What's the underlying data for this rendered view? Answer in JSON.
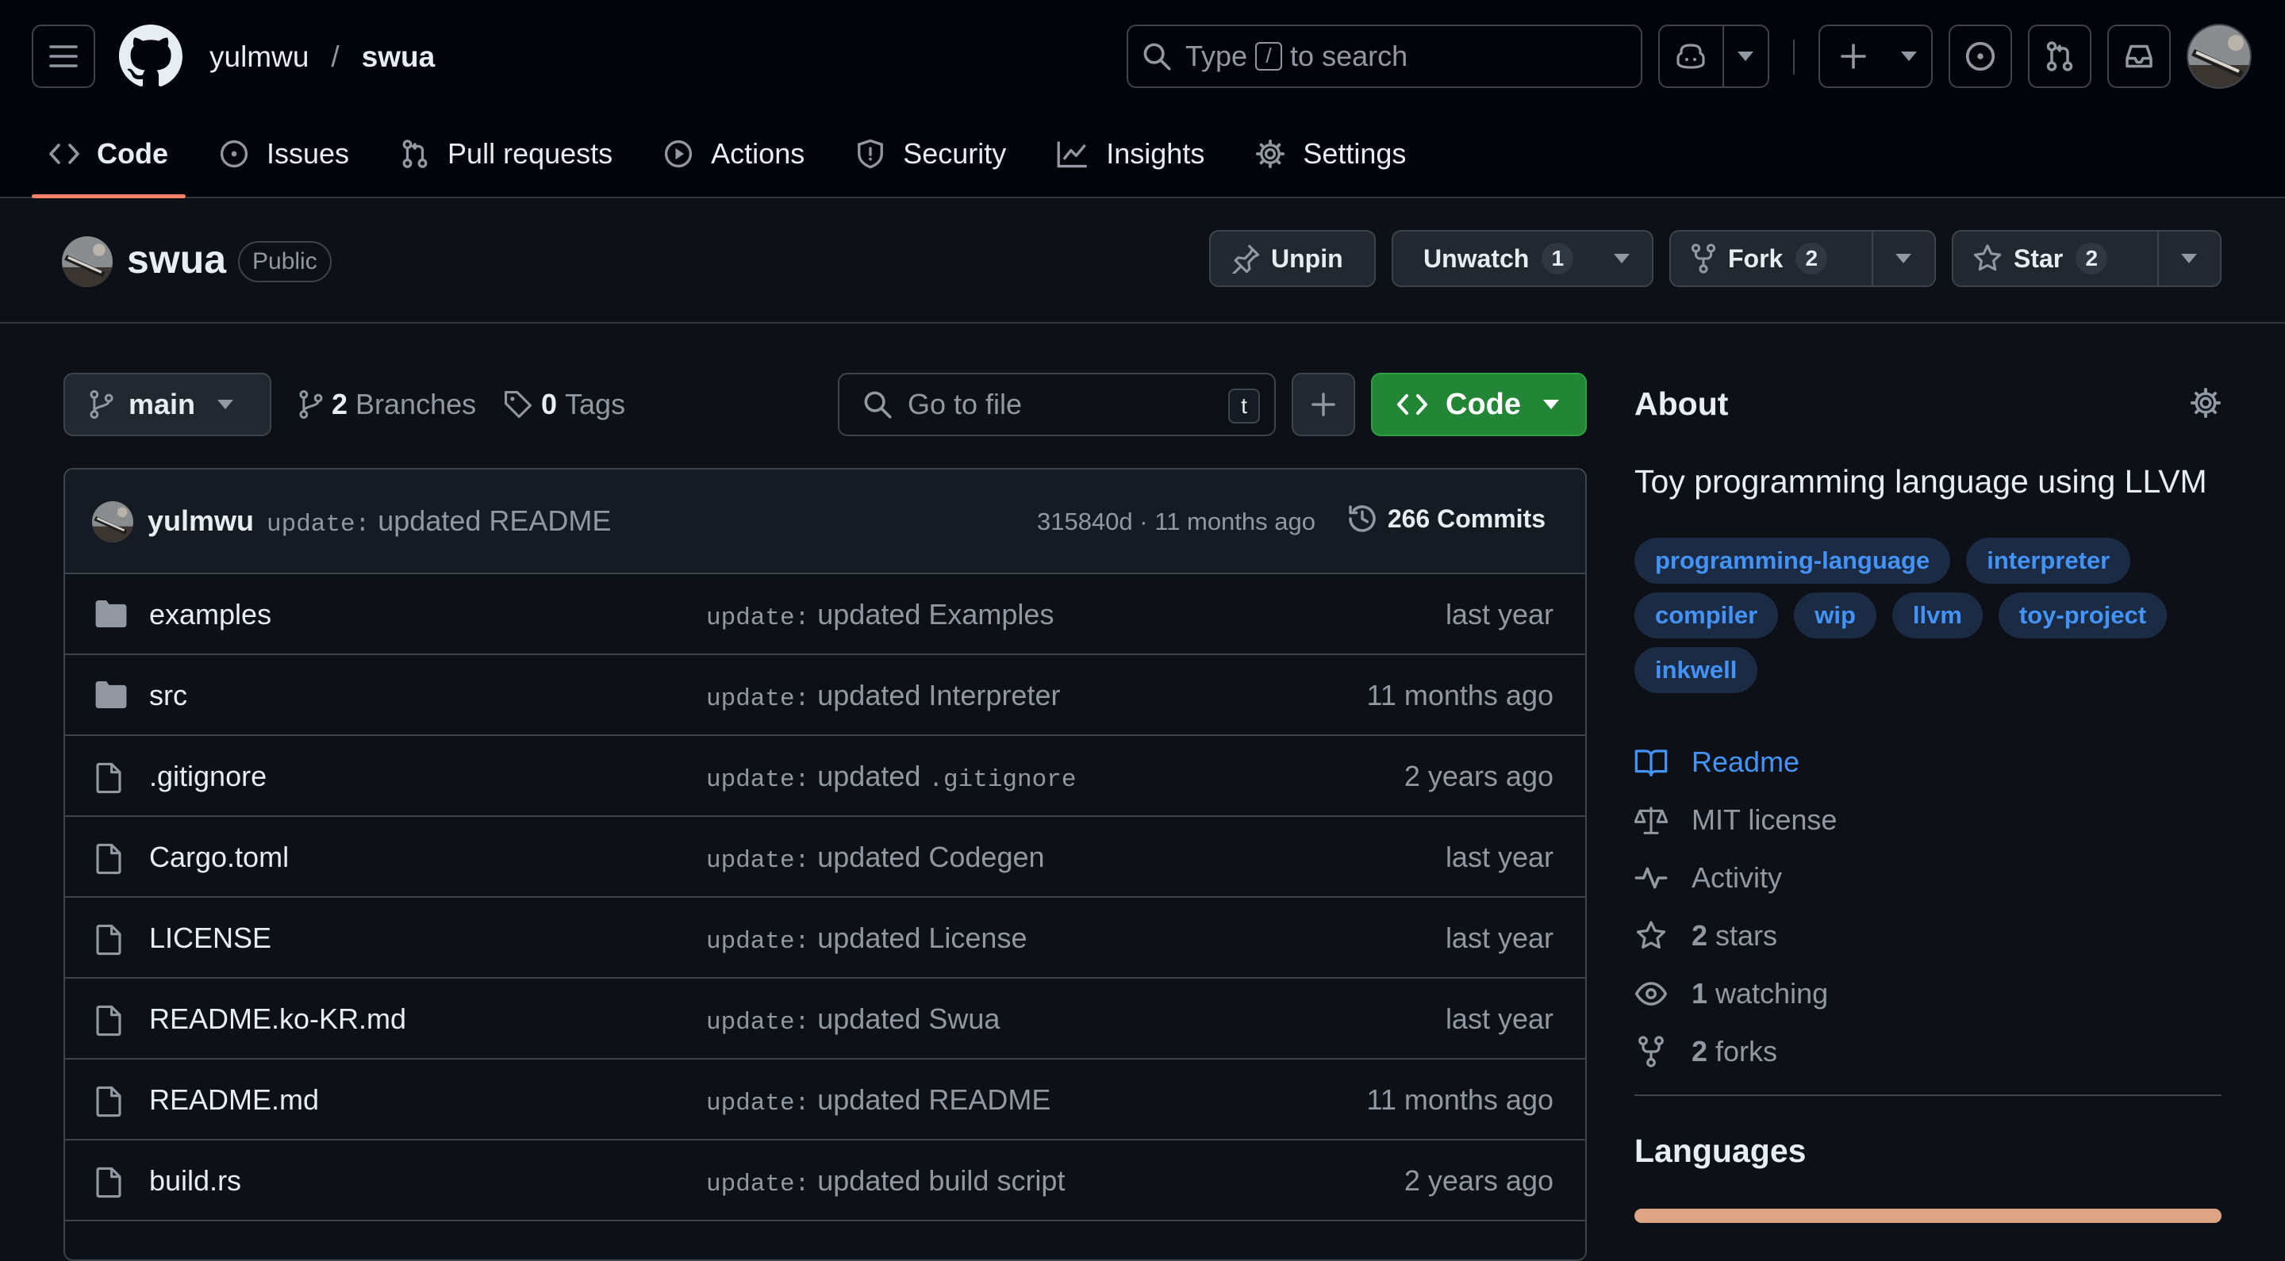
{
  "header": {
    "owner": "yulmwu",
    "separator": "/",
    "repo": "swua",
    "search": {
      "prefix": "Type",
      "key": "/",
      "suffix": "to search"
    }
  },
  "nav": {
    "tabs": [
      {
        "label": "Code",
        "icon": "code-icon",
        "active": true
      },
      {
        "label": "Issues",
        "icon": "issue-icon"
      },
      {
        "label": "Pull requests",
        "icon": "pull-request-icon"
      },
      {
        "label": "Actions",
        "icon": "play-icon"
      },
      {
        "label": "Security",
        "icon": "shield-icon"
      },
      {
        "label": "Insights",
        "icon": "graph-icon"
      },
      {
        "label": "Settings",
        "icon": "gear-icon"
      }
    ]
  },
  "repo": {
    "name": "swua",
    "visibility": "Public",
    "unpin_label": "Unpin",
    "unwatch_label": "Unwatch",
    "watch_count": "1",
    "fork_label": "Fork",
    "fork_count": "2",
    "star_label": "Star",
    "star_count": "2"
  },
  "toolbar": {
    "branch": "main",
    "branches_count": "2",
    "branches_label": "Branches",
    "tags_count": "0",
    "tags_label": "Tags",
    "goto_placeholder": "Go to file",
    "goto_key": "t",
    "code_label": "Code"
  },
  "commit": {
    "author": "yulmwu",
    "prefix": "update:",
    "message": "updated README",
    "meta": "315840d · 11 months ago",
    "count": "266 Commits"
  },
  "files": [
    {
      "type": "folder",
      "name": "examples",
      "prefix": "update:",
      "msg": "updated Examples",
      "code": "",
      "date": "last year"
    },
    {
      "type": "folder",
      "name": "src",
      "prefix": "update:",
      "msg": "updated Interpreter",
      "code": "",
      "date": "11 months ago"
    },
    {
      "type": "file",
      "name": ".gitignore",
      "prefix": "update:",
      "msg": "updated",
      "code": ".gitignore",
      "date": "2 years ago"
    },
    {
      "type": "file",
      "name": "Cargo.toml",
      "prefix": "update:",
      "msg": "updated Codegen",
      "code": "",
      "date": "last year"
    },
    {
      "type": "file",
      "name": "LICENSE",
      "prefix": "update:",
      "msg": "updated License",
      "code": "",
      "date": "last year"
    },
    {
      "type": "file",
      "name": "README.ko-KR.md",
      "prefix": "update:",
      "msg": "updated Swua",
      "code": "",
      "date": "last year"
    },
    {
      "type": "file",
      "name": "README.md",
      "prefix": "update:",
      "msg": "updated README",
      "code": "",
      "date": "11 months ago"
    },
    {
      "type": "file",
      "name": "build.rs",
      "prefix": "update:",
      "msg": "updated build script",
      "code": "",
      "date": "2 years ago"
    }
  ],
  "about": {
    "heading": "About",
    "description": "Toy programming language using LLVM",
    "topics": [
      "programming-language",
      "interpreter",
      "compiler",
      "wip",
      "llvm",
      "toy-project",
      "inkwell"
    ],
    "links": [
      {
        "icon": "book-icon",
        "num": "",
        "text": "Readme",
        "link": true
      },
      {
        "icon": "law-icon",
        "num": "",
        "text": "MIT license",
        "link": false
      },
      {
        "icon": "pulse-icon",
        "num": "",
        "text": "Activity",
        "link": false
      },
      {
        "icon": "star-icon",
        "num": "2",
        "text": "stars",
        "link": false
      },
      {
        "icon": "eye-icon",
        "num": "1",
        "text": "watching",
        "link": false
      },
      {
        "icon": "fork-icon",
        "num": "2",
        "text": "forks",
        "link": false
      }
    ],
    "languages_heading": "Languages"
  },
  "colors": {
    "accent_link": "#4493f8",
    "primary_button": "#238636",
    "active_tab_underline": "#f78166",
    "language_bar": "#dea584"
  }
}
